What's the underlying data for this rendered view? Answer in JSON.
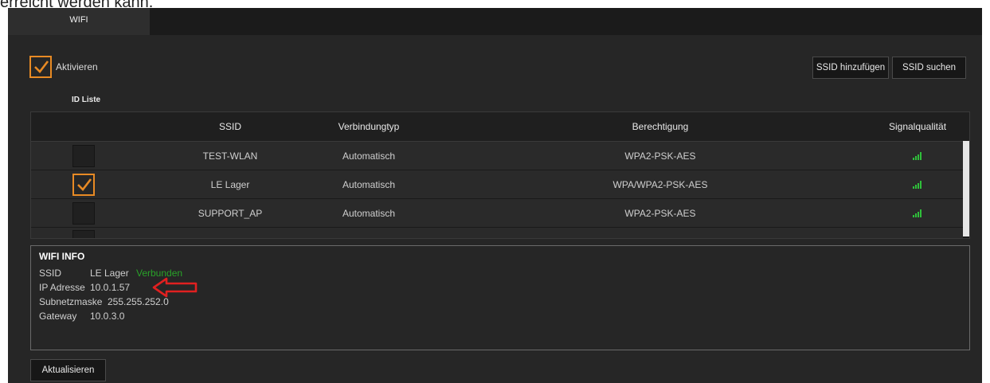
{
  "above_text": "erreicht werden kann.",
  "tabs": [
    {
      "label": "WIFI",
      "active": true
    }
  ],
  "activate": {
    "label": "Aktivieren",
    "checked": true
  },
  "toolbar": {
    "add_ssid": "SSID hinzufügen",
    "search_ssid": "SSID suchen"
  },
  "id_list_label": "ID Liste",
  "table": {
    "columns": [
      "",
      "SSID",
      "Verbindungtyp",
      "Berechtigung",
      "Signalqualität"
    ],
    "rows": [
      {
        "checked": false,
        "ssid": "TEST-WLAN",
        "type": "Automatisch",
        "auth": "WPA2-PSK-AES",
        "signal": "signal-bars-icon"
      },
      {
        "checked": true,
        "ssid": "LE Lager",
        "type": "Automatisch",
        "auth": "WPA/WPA2-PSK-AES",
        "signal": "signal-bars-icon"
      },
      {
        "checked": false,
        "ssid": "SUPPORT_AP",
        "type": "Automatisch",
        "auth": "WPA2-PSK-AES",
        "signal": "signal-bars-icon"
      },
      {
        "checked": false,
        "ssid": "",
        "type": "",
        "auth": "",
        "signal": "signal-bars-icon"
      }
    ]
  },
  "wifi_info": {
    "title": "WIFI INFO",
    "ssid_key": "SSID",
    "ssid_value": "LE Lager",
    "status": "Verbunden",
    "ip_key": "IP Adresse",
    "ip_value": "10.0.1.57",
    "subnet_key": "Subnetzmaske",
    "subnet_value": "255.255.252.0",
    "gateway_key": "Gateway",
    "gateway_value": "10.0.3.0"
  },
  "refresh_button": "Aktualisieren",
  "colors": {
    "accent": "#e88a24",
    "connected": "#29a329",
    "annotation_arrow": "#e02020",
    "signal": "#2fbf3a"
  }
}
